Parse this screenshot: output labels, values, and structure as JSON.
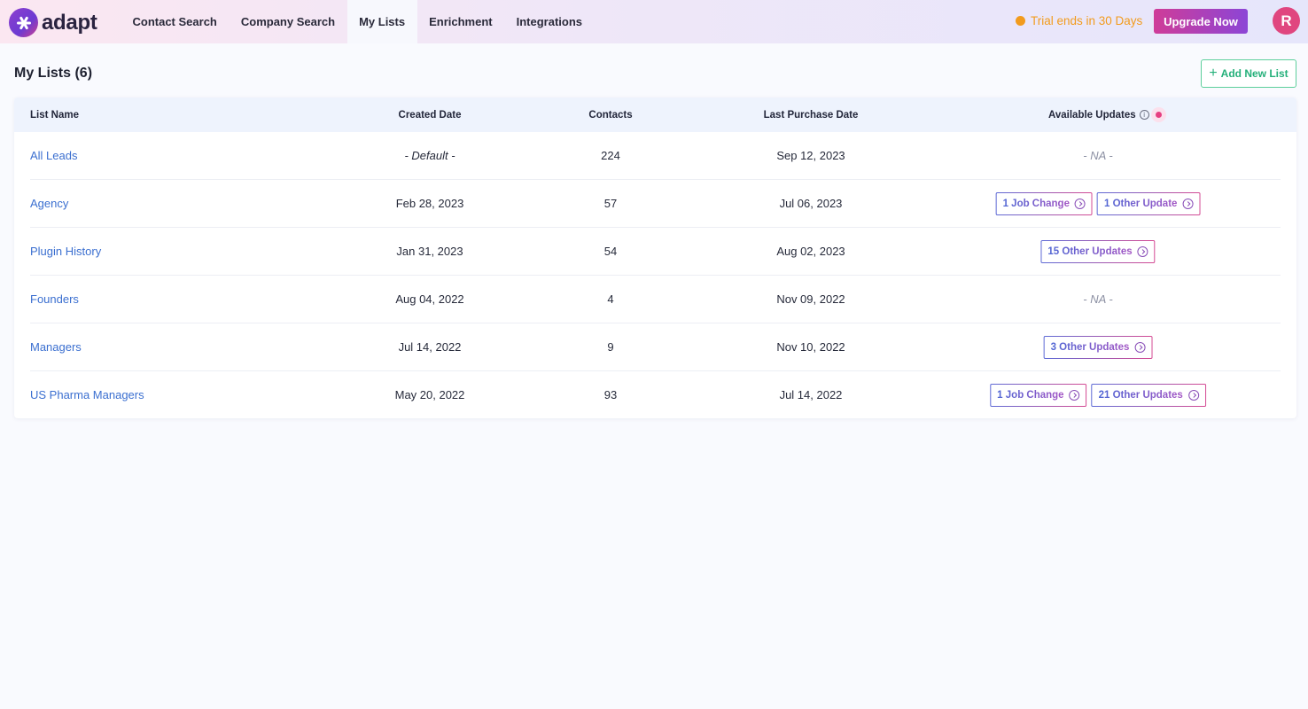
{
  "app": {
    "logo_text": "adapt"
  },
  "nav": {
    "items": [
      {
        "label": "Contact Search",
        "active": false
      },
      {
        "label": "Company Search",
        "active": false
      },
      {
        "label": "My Lists",
        "active": true
      },
      {
        "label": "Enrichment",
        "active": false
      },
      {
        "label": "Integrations",
        "active": false
      }
    ],
    "trial_text": "Trial ends in 30 Days",
    "upgrade_label": "Upgrade Now",
    "avatar_initial": "R"
  },
  "page": {
    "title": "My Lists (6)",
    "add_button_label": "Add New List"
  },
  "table": {
    "headers": {
      "list_name": "List Name",
      "created_date": "Created Date",
      "contacts": "Contacts",
      "last_purchase_date": "Last Purchase Date",
      "available_updates": "Available Updates"
    },
    "rows": [
      {
        "name": "All Leads",
        "created": "- Default -",
        "contacts": "224",
        "last_purchase": "Sep 12, 2023",
        "updates": [],
        "na": "- NA -"
      },
      {
        "name": "Agency",
        "created": "Feb 28, 2023",
        "contacts": "57",
        "last_purchase": "Jul 06, 2023",
        "updates": [
          "1 Job Change",
          "1 Other Update"
        ]
      },
      {
        "name": "Plugin History",
        "created": "Jan 31, 2023",
        "contacts": "54",
        "last_purchase": "Aug 02, 2023",
        "updates": [
          "15 Other Updates"
        ]
      },
      {
        "name": "Founders",
        "created": "Aug 04, 2022",
        "contacts": "4",
        "last_purchase": "Nov 09, 2022",
        "updates": [],
        "na": "- NA -"
      },
      {
        "name": "Managers",
        "created": "Jul 14, 2022",
        "contacts": "9",
        "last_purchase": "Nov 10, 2022",
        "updates": [
          "3 Other Updates"
        ]
      },
      {
        "name": "US Pharma Managers",
        "created": "May 20, 2022",
        "contacts": "93",
        "last_purchase": "Jul 14, 2022",
        "updates": [
          "1 Job Change",
          "21 Other Updates"
        ]
      }
    ]
  },
  "colors": {
    "brand_gradient_start": "#cf3c98",
    "brand_gradient_end": "#8c45d6",
    "trial_orange": "#f29b1d",
    "link_blue": "#3b6fd0",
    "add_green": "#25b07a",
    "avatar_pink": "#e0467f"
  }
}
